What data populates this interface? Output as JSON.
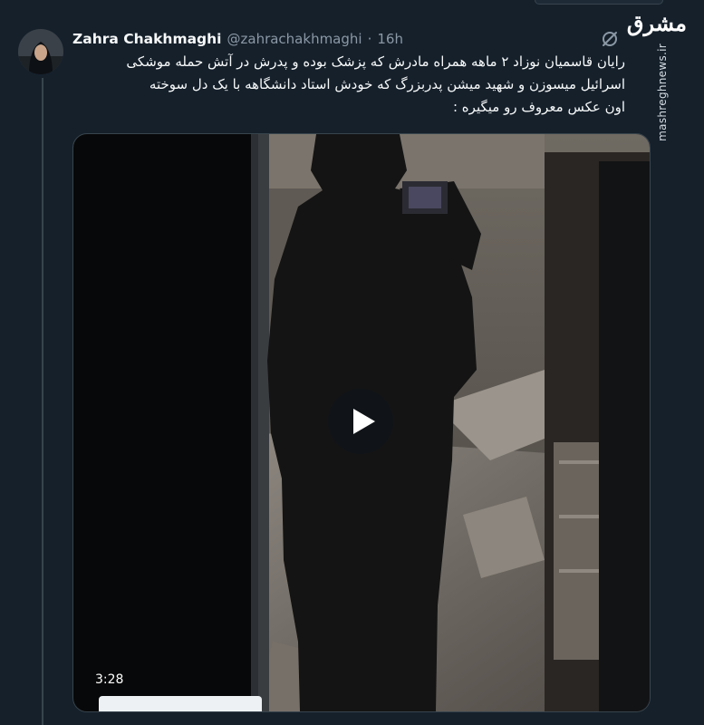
{
  "tweet": {
    "display_name": "Zahra Chakhmaghi",
    "handle": "@zahrachakhmaghi",
    "separator": "·",
    "timestamp": "16h",
    "text_lines": [
      "رایان قاسمیان نوزاد ۲ ماهه همراه مادرش که پزشک بوده و پدرش در آتش حمله موشکی",
      "اسرائیل میسوزن و شهید میشن پدربزرگ که خودش استاد دانشگاهه با یک دل سوخته",
      "اون عکس معروف رو میگیره :"
    ]
  },
  "video": {
    "duration": "3:28",
    "play_icon": "play-icon"
  },
  "watermark": {
    "logo_text": "مشرق",
    "url": "mashreghnews.ir"
  },
  "icons": {
    "grok": "grok-slash-circle-icon"
  },
  "colors": {
    "background": "#15202b",
    "text_primary": "#f7f9f9",
    "text_secondary": "#8b98a5",
    "border": "#38444d"
  }
}
